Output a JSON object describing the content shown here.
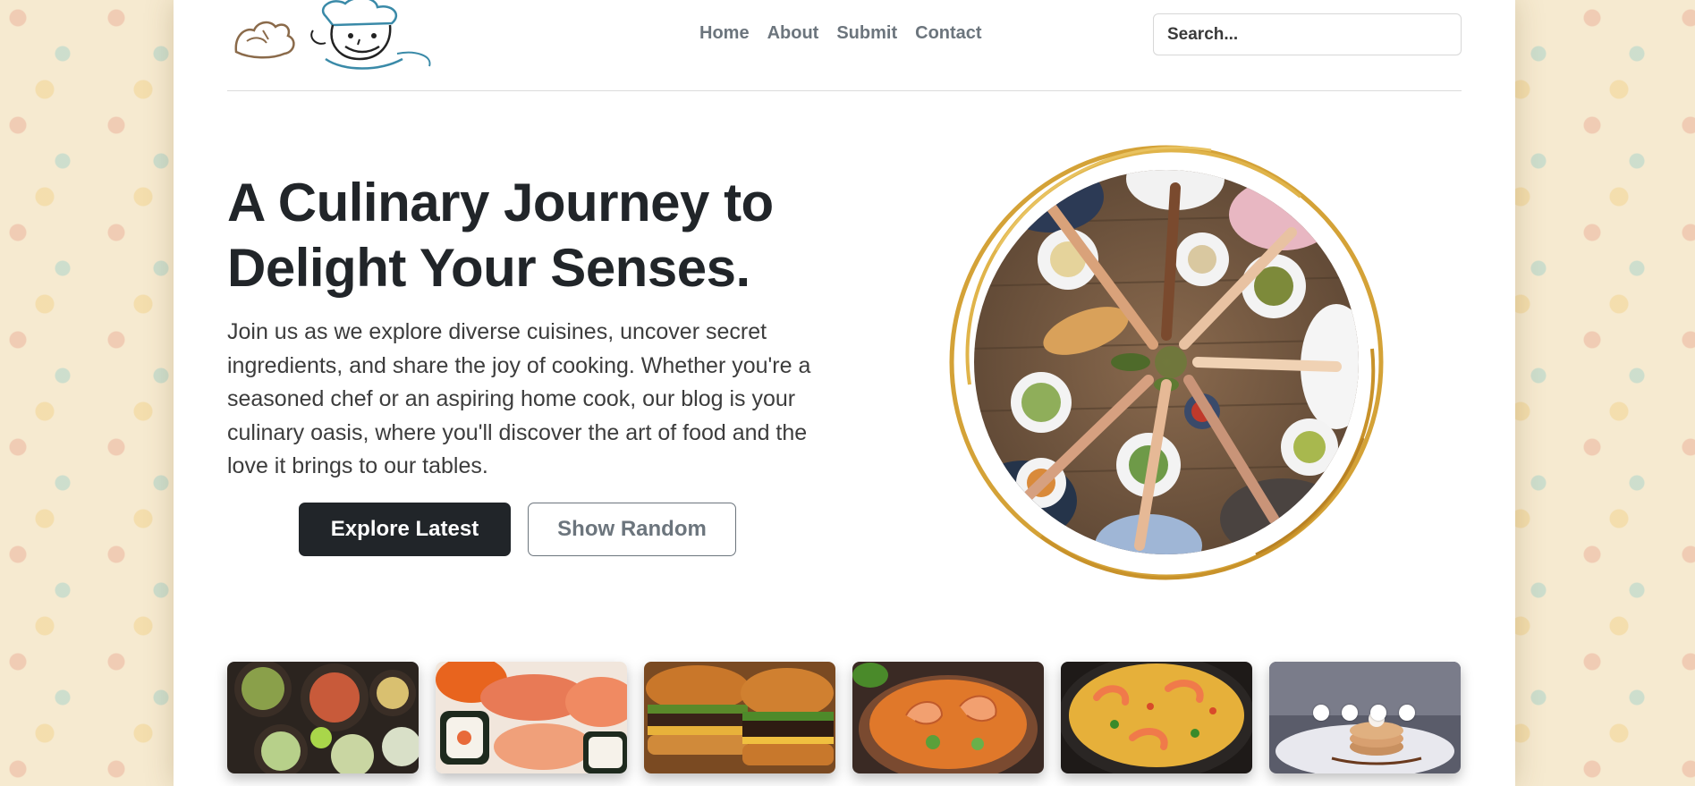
{
  "nav": {
    "items": [
      {
        "label": "Home"
      },
      {
        "label": "About"
      },
      {
        "label": "Submit"
      },
      {
        "label": "Contact"
      }
    ]
  },
  "search": {
    "placeholder": "Search..."
  },
  "hero": {
    "title": "A Culinary Journey to Delight Your Senses.",
    "text": "Join us as we explore diverse cuisines, uncover secret ingredients, and share the joy of cooking. Whether you're a seasoned chef or an aspiring home cook, our blog is your culinary oasis, where you'll discover the art of food and the love it brings to our tables.",
    "primary_button": "Explore Latest",
    "secondary_button": "Show Random"
  },
  "thumbnails": {
    "items": [
      {
        "subject": "asian-bowls"
      },
      {
        "subject": "sushi"
      },
      {
        "subject": "burger"
      },
      {
        "subject": "shrimp-soup"
      },
      {
        "subject": "paella"
      },
      {
        "subject": "pancake-dessert"
      }
    ],
    "indicator_count": 4
  },
  "colors": {
    "primary": "#212529",
    "muted": "#6c757d",
    "gold": "#d4a237",
    "page_bg": "#f6ead0"
  }
}
